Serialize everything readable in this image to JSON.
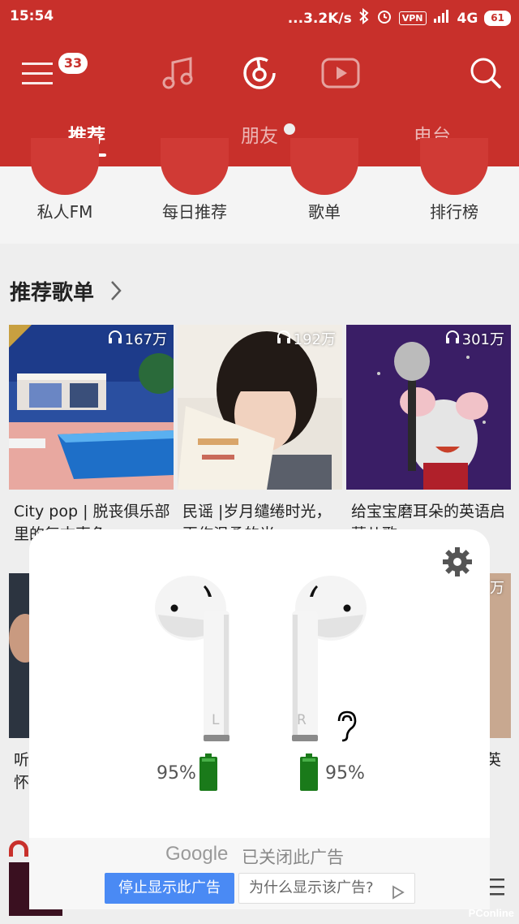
{
  "status": {
    "time": "15:54",
    "speed": "...3.2K/s",
    "vpn": "VPN",
    "network": "4G",
    "battery": "61"
  },
  "topnav": {
    "badge": "33"
  },
  "tabs": [
    {
      "label": "推荐"
    },
    {
      "label": "朋友"
    },
    {
      "label": "电台"
    }
  ],
  "quick": [
    {
      "label": "私人FM"
    },
    {
      "label": "每日推荐"
    },
    {
      "label": "歌单"
    },
    {
      "label": "排行榜"
    }
  ],
  "section": {
    "title": "推荐歌单"
  },
  "playlists": [
    {
      "count": "167万",
      "title": "City pop | 脱丧俱乐部里的复古声色"
    },
    {
      "count": "192万",
      "title": "民谣 |岁月缱绻时光，再作温柔的光"
    },
    {
      "count": "301万",
      "title": "给宝宝磨耳朵的英语启蒙儿歌"
    },
    {
      "count": "",
      "title": "听怀"
    },
    {
      "count": "万",
      "title": "英"
    }
  ],
  "popup": {
    "left_letter": "L",
    "right_letter": "R",
    "left_battery": "95%",
    "right_battery": "95%",
    "ad_google": "Google",
    "ad_closed": "已关闭此广告",
    "ad_stop": "停止显示此广告",
    "ad_why": "为什么显示该广告?"
  },
  "watermark": "PConline",
  "colors": {
    "brand": "#c8302b",
    "battery_green": "#1a7a1a",
    "ad_blue": "#4a8af4"
  }
}
